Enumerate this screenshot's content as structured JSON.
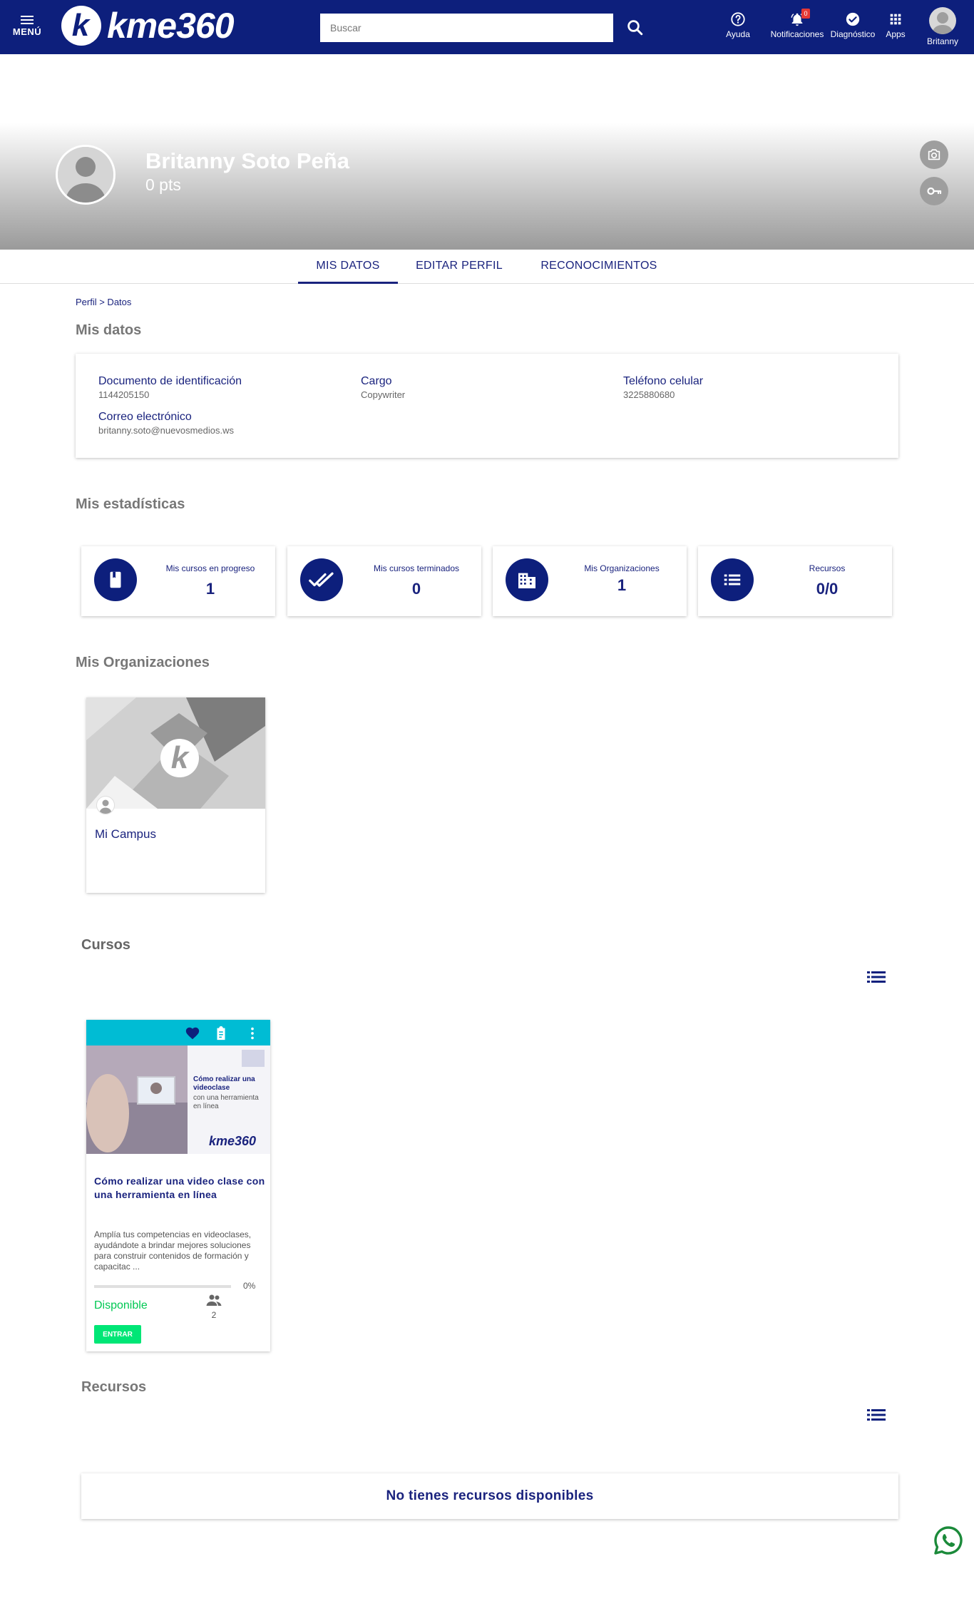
{
  "header": {
    "menu_label": "MENÚ",
    "logo_letter": "k",
    "logo_text": "kme360",
    "search_placeholder": "Buscar",
    "nav": {
      "help": "Ayuda",
      "notifications": "Notificaciones",
      "notifications_count": "0",
      "diagnostic": "Diagnóstico",
      "apps": "Apps",
      "user": "Britanny"
    }
  },
  "profile": {
    "name": "Britanny Soto Peña",
    "points": "0 pts"
  },
  "tabs": [
    "MIS DATOS",
    "EDITAR PERFIL",
    "RECONOCIMIENTOS"
  ],
  "breadcrumb": "Perfil > Datos",
  "mis_datos": {
    "title": "Mis datos",
    "fields": [
      {
        "label": "Documento de identificación",
        "value": "1144205150"
      },
      {
        "label": "Cargo",
        "value": "Copywriter"
      },
      {
        "label": "Teléfono celular",
        "value": "3225880680"
      },
      {
        "label": "Correo electrónico",
        "value": "britanny.soto@nuevosmedios.ws"
      }
    ]
  },
  "estadisticas": {
    "title": "Mis estadísticas",
    "cards": [
      {
        "label": "Mis cursos en progreso",
        "value": "1",
        "icon": "book-icon"
      },
      {
        "label": "Mis cursos terminados",
        "value": "0",
        "icon": "double-check-icon"
      },
      {
        "label": "Mis Organizaciones",
        "value": "1",
        "icon": "building-icon"
      },
      {
        "label": "Recursos",
        "value": "0/0",
        "icon": "list-icon"
      }
    ]
  },
  "organizaciones": {
    "title": "Mis Organizaciones",
    "items": [
      {
        "name": "Mi Campus",
        "logo_letter": "k"
      }
    ]
  },
  "cursos": {
    "title": "Cursos",
    "items": [
      {
        "image_heading": "Cómo realizar una videoclase",
        "image_sub": "con una herramienta en línea",
        "image_brand": "kme360",
        "title": "Cómo realizar una video clase con una herramienta en línea",
        "description": "Amplía tus competencias en videoclases, ayudándote a brindar mejores soluciones para construir contenidos de formación y capacitac ...",
        "progress": 0,
        "progress_label": "0%",
        "status": "Disponible",
        "users": "2",
        "button": "ENTRAR"
      }
    ]
  },
  "recursos": {
    "title": "Recursos",
    "empty_message": "No tienes recursos disponibles"
  },
  "colors": {
    "primary": "#0d1f7c",
    "accent": "#00bcd4",
    "success": "#00c853"
  }
}
